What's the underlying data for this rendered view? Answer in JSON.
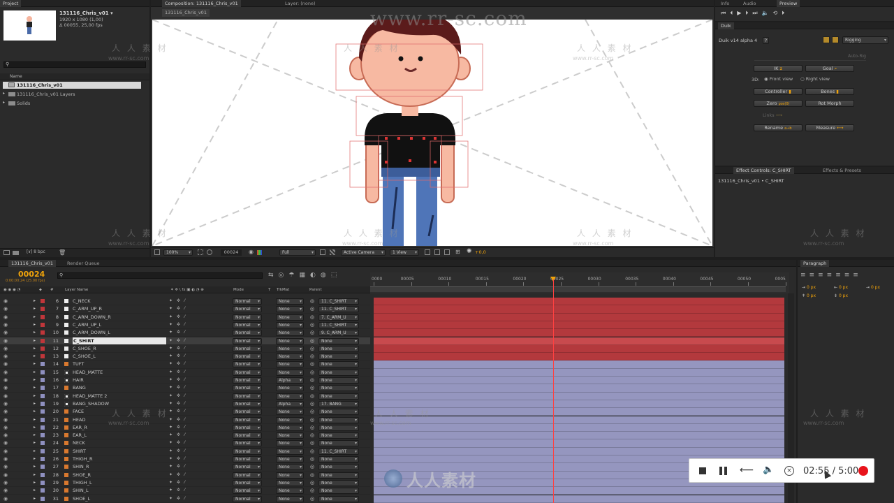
{
  "watermark": {
    "url_large": "www.rr-sc.com",
    "cn": "人人素材",
    "cn_spaced": "人 人 素 材",
    "url_small": "www.rr-sc.com"
  },
  "project": {
    "tab": "Project",
    "comp_name": "131116_Chris_v01 ▾",
    "comp_size": "1920 x 1080 (1,00)",
    "comp_duration": "Δ 00055, 25,00 fps",
    "search_placeholder": "",
    "name_header": "Name",
    "items": [
      "131116_Chris_v01",
      "131116_Chris_v01 Layers",
      "Solids"
    ],
    "bpc": "8 bpc"
  },
  "comp_viewer": {
    "tab": "Composition: 131116_Chris_v01",
    "layer_tab": "Layer: (none)",
    "sub_tab": "131116_Chris_v01",
    "zoom": "100%",
    "timecode": "00024",
    "resolution": "Full",
    "camera": "Active Camera",
    "views": "1 View",
    "exposure": "+0,0"
  },
  "top_right": {
    "tabs": [
      "Info",
      "Audio",
      "Preview"
    ],
    "duik_tab": "Duik",
    "duik_version": "Duik v14 alpha 4",
    "help": "?",
    "rigging_select": "Rigging",
    "autorig": "Auto-Rig",
    "ik": "IK",
    "goal": "Goal",
    "three_d": "3D:",
    "front_view": "Front view",
    "right_view": "Right view",
    "controller": "Controller",
    "bones": "Bones",
    "zero": "Zero",
    "zero_badge": "pos(0)",
    "rot_morph": "Rot Morph",
    "links": "Links",
    "rename": "Rename",
    "rename_badge": "a→b",
    "measure": "Measure"
  },
  "effects": {
    "tab": "Effect Controls: C_SHIRT",
    "tab2": "Effects & Presets",
    "breadcrumb": "131116_Chris_v01 • C_SHIRT"
  },
  "timeline": {
    "tab": "131116_Chris_v01",
    "tab2": "Render Queue",
    "current_time": "00024",
    "time_sub": "0:00:00:24 (25.00 fps)",
    "headers": {
      "num": "#",
      "layer_name": "Layer Name",
      "mode": "Mode",
      "t": "T",
      "trkmat": "TrkMat",
      "parent": "Parent"
    },
    "ruler": [
      "0000",
      "00005",
      "00010",
      "00015",
      "00020",
      "00025",
      "00030",
      "00035",
      "00040",
      "00045",
      "00050",
      "0005"
    ],
    "layers": [
      {
        "num": "6",
        "name": "C_NECK",
        "mode": "Normal",
        "trk": "None",
        "parent": "11. C_SHIRT",
        "color": "#c0363a",
        "type": "solid"
      },
      {
        "num": "7",
        "name": "C_ARM_UP_R",
        "mode": "Normal",
        "trk": "None",
        "parent": "11. C_SHIRT",
        "color": "#c0363a",
        "type": "solid"
      },
      {
        "num": "8",
        "name": "C_ARM_DOWN_R",
        "mode": "Normal",
        "trk": "None",
        "parent": "7. C_ARM_U",
        "color": "#c0363a",
        "type": "solid"
      },
      {
        "num": "9",
        "name": "C_ARM_UP_L",
        "mode": "Normal",
        "trk": "None",
        "parent": "11. C_SHIRT",
        "color": "#c0363a",
        "type": "solid"
      },
      {
        "num": "10",
        "name": "C_ARM_DOWN_L",
        "mode": "Normal",
        "trk": "None",
        "parent": "9. C_ARM_U",
        "color": "#c0363a",
        "type": "solid"
      },
      {
        "num": "11",
        "name": "C_SHIRT",
        "mode": "Normal",
        "trk": "None",
        "parent": "None",
        "color": "#c0363a",
        "type": "solid",
        "selected": true
      },
      {
        "num": "12",
        "name": "C_SHOE_R",
        "mode": "Normal",
        "trk": "None",
        "parent": "None",
        "color": "#c0363a",
        "type": "solid"
      },
      {
        "num": "13",
        "name": "C_SHOE_L",
        "mode": "Normal",
        "trk": "None",
        "parent": "None",
        "color": "#c0363a",
        "type": "solid"
      },
      {
        "num": "14",
        "name": "TUFT",
        "mode": "Normal",
        "trk": "None",
        "parent": "None",
        "color": "#8f90c0",
        "type": "ai"
      },
      {
        "num": "15",
        "name": "HEAD_MATTE",
        "mode": "Normal",
        "trk": "None",
        "parent": "None",
        "color": "#8f90c0",
        "type": "matte"
      },
      {
        "num": "16",
        "name": "HAIR",
        "mode": "Normal",
        "trk": "Alpha",
        "parent": "None",
        "color": "#8f90c0",
        "type": "matte"
      },
      {
        "num": "17",
        "name": "BANG",
        "mode": "Normal",
        "trk": "None",
        "parent": "None",
        "color": "#8f90c0",
        "type": "ai"
      },
      {
        "num": "18",
        "name": "HEAD_MATTE 2",
        "mode": "Normal",
        "trk": "None",
        "parent": "None",
        "color": "#8f90c0",
        "type": "matte"
      },
      {
        "num": "19",
        "name": "BANG_SHADOW",
        "mode": "Normal",
        "trk": "Alpha",
        "parent": "17. BANG",
        "color": "#8f90c0",
        "type": "matte"
      },
      {
        "num": "20",
        "name": "FACE",
        "mode": "Normal",
        "trk": "None",
        "parent": "None",
        "color": "#8f90c0",
        "type": "ai"
      },
      {
        "num": "21",
        "name": "HEAD",
        "mode": "Normal",
        "trk": "None",
        "parent": "None",
        "color": "#8f90c0",
        "type": "ai"
      },
      {
        "num": "22",
        "name": "EAR_R",
        "mode": "Normal",
        "trk": "None",
        "parent": "None",
        "color": "#8f90c0",
        "type": "ai"
      },
      {
        "num": "23",
        "name": "EAR_L",
        "mode": "Normal",
        "trk": "None",
        "parent": "None",
        "color": "#8f90c0",
        "type": "ai"
      },
      {
        "num": "24",
        "name": "NECK",
        "mode": "Normal",
        "trk": "None",
        "parent": "None",
        "color": "#8f90c0",
        "type": "ai"
      },
      {
        "num": "25",
        "name": "SHIRT",
        "mode": "Normal",
        "trk": "None",
        "parent": "11. C_SHIRT",
        "color": "#8f90c0",
        "type": "ai"
      },
      {
        "num": "26",
        "name": "THIGH_R",
        "mode": "Normal",
        "trk": "None",
        "parent": "None",
        "color": "#8f90c0",
        "type": "ai"
      },
      {
        "num": "27",
        "name": "SHIN_R",
        "mode": "Normal",
        "trk": "None",
        "parent": "None",
        "color": "#8f90c0",
        "type": "ai"
      },
      {
        "num": "28",
        "name": "SHOE_R",
        "mode": "Normal",
        "trk": "None",
        "parent": "None",
        "color": "#8f90c0",
        "type": "ai"
      },
      {
        "num": "29",
        "name": "THIGH_L",
        "mode": "Normal",
        "trk": "None",
        "parent": "None",
        "color": "#8f90c0",
        "type": "ai"
      },
      {
        "num": "30",
        "name": "SHIN_L",
        "mode": "Normal",
        "trk": "None",
        "parent": "None",
        "color": "#8f90c0",
        "type": "ai"
      },
      {
        "num": "31",
        "name": "SHOE_L",
        "mode": "Normal",
        "trk": "None",
        "parent": "None",
        "color": "#8f90c0",
        "type": "ai"
      }
    ]
  },
  "paragraph": {
    "tab": "Paragraph",
    "px1": "0 px",
    "px2": "0 px",
    "px3": "0 px",
    "px4": "0 px",
    "px5": "0 px"
  },
  "player": {
    "time": "02:55 / 5:00"
  },
  "colors": {
    "accent": "#f0a30a",
    "record": "#e8131b",
    "playhead": "#ff4040",
    "red_label": "#b3393d",
    "lavender_label": "#9596bf"
  }
}
